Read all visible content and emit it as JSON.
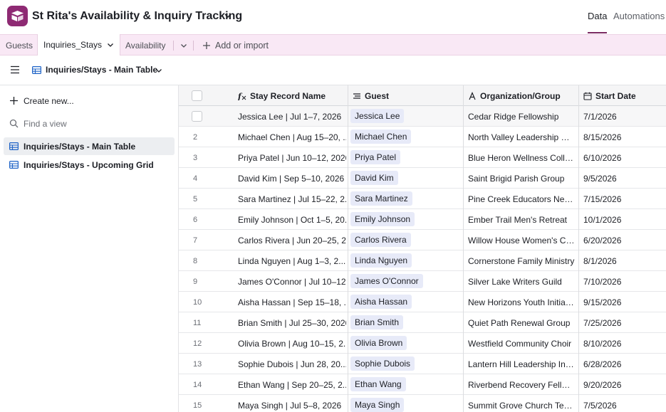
{
  "app": {
    "base_title": "St Rita's Availability & Inquiry Tracking",
    "top_tabs": {
      "data": "Data",
      "automations": "Automations"
    },
    "accent": "#8e2a73"
  },
  "tables": {
    "guests": "Guests",
    "inquiries_stays": "Inquiries_Stays",
    "availability": "Availability",
    "add_or_import": "Add or import"
  },
  "view_bar": {
    "current_view": "Inquiries/Stays - Main Table"
  },
  "sidebar": {
    "create_new": "Create new...",
    "find_placeholder": "Find a view",
    "views": [
      "Inquiries/Stays - Main Table",
      "Inquiries/Stays - Upcoming Grid"
    ]
  },
  "columns": {
    "stay_record_name": "Stay Record Name",
    "guest": "Guest",
    "organization": "Organization/Group",
    "start_date": "Start Date"
  },
  "rows": [
    {
      "num": "",
      "name": "Jessica Lee | Jul 1–7, 2026",
      "guest": "Jessica Lee",
      "org": "Cedar Ridge Fellowship",
      "date": "7/1/2026"
    },
    {
      "num": "2",
      "name": "Michael Chen | Aug 15–20, ...",
      "guest": "Michael Chen",
      "org": "North Valley Leadership Cir...",
      "date": "8/15/2026"
    },
    {
      "num": "3",
      "name": "Priya Patel | Jun 10–12, 2026",
      "guest": "Priya Patel",
      "org": "Blue Heron Wellness Collec...",
      "date": "6/10/2026"
    },
    {
      "num": "4",
      "name": "David Kim | Sep 5–10, 2026",
      "guest": "David Kim",
      "org": "Saint Brigid Parish Group",
      "date": "9/5/2026"
    },
    {
      "num": "5",
      "name": "Sara Martinez | Jul 15–22, 2...",
      "guest": "Sara Martinez",
      "org": "Pine Creek Educators Netw...",
      "date": "7/15/2026"
    },
    {
      "num": "6",
      "name": "Emily Johnson | Oct 1–5, 20...",
      "guest": "Emily Johnson",
      "org": "Ember Trail Men's Retreat",
      "date": "10/1/2026"
    },
    {
      "num": "7",
      "name": "Carlos Rivera | Jun 20–25, 2...",
      "guest": "Carlos Rivera",
      "org": "Willow House Women's Cir...",
      "date": "6/20/2026"
    },
    {
      "num": "8",
      "name": "Linda Nguyen | Aug 1–3, 2...",
      "guest": "Linda Nguyen",
      "org": "Cornerstone Family Ministry",
      "date": "8/1/2026"
    },
    {
      "num": "9",
      "name": "James O'Connor | Jul 10–12...",
      "guest": "James O'Connor",
      "org": "Silver Lake Writers Guild",
      "date": "7/10/2026"
    },
    {
      "num": "10",
      "name": "Aisha Hassan | Sep 15–18, ...",
      "guest": "Aisha Hassan",
      "org": "New Horizons Youth Initiati...",
      "date": "9/15/2026"
    },
    {
      "num": "11",
      "name": "Brian Smith | Jul 25–30, 2026",
      "guest": "Brian Smith",
      "org": "Quiet Path Renewal Group",
      "date": "7/25/2026"
    },
    {
      "num": "12",
      "name": "Olivia Brown | Aug 10–15, 2...",
      "guest": "Olivia Brown",
      "org": "Westfield Community Choir",
      "date": "8/10/2026"
    },
    {
      "num": "13",
      "name": "Sophie Dubois | Jun 28, 20...",
      "guest": "Sophie Dubois",
      "org": "Lantern Hill Leadership Inst...",
      "date": "6/28/2026"
    },
    {
      "num": "14",
      "name": "Ethan Wang | Sep 20–25, 2...",
      "guest": "Ethan Wang",
      "org": "Riverbend Recovery Fellow...",
      "date": "9/20/2026"
    },
    {
      "num": "15",
      "name": "Maya Singh | Jul 5–8, 2026",
      "guest": "Maya Singh",
      "org": "Summit Grove Church Team",
      "date": "7/5/2026"
    }
  ]
}
